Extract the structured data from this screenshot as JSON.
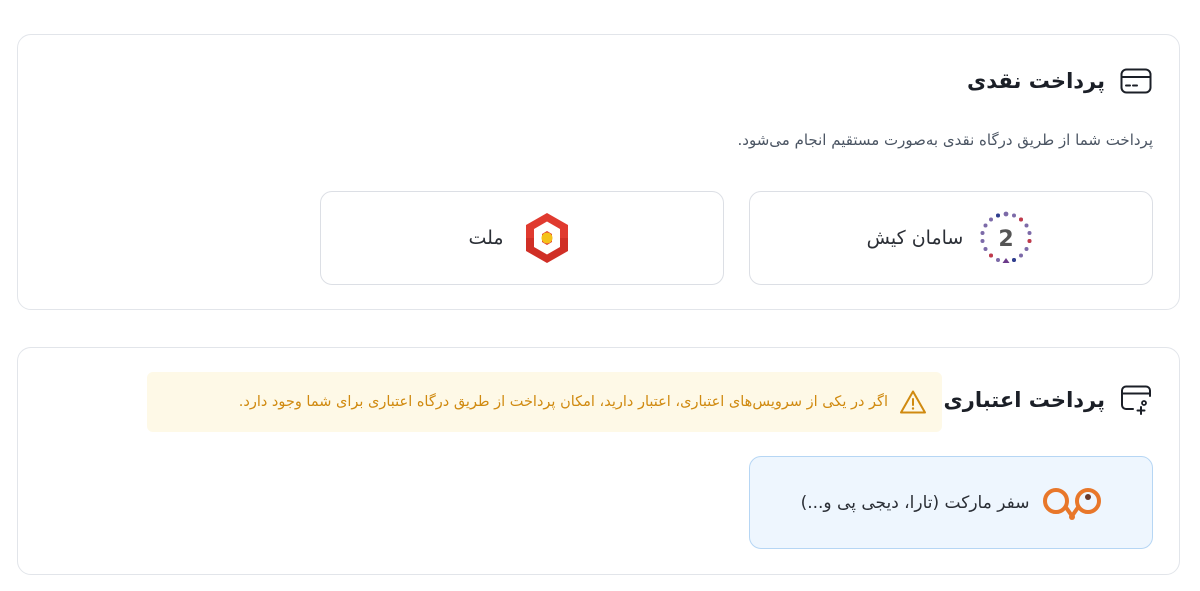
{
  "cash": {
    "title": "پرداخت نقدی",
    "description": "پرداخت شما از طریق درگاه نقدی به‌صورت مستقیم انجام می‌شود.",
    "icon": "card-icon",
    "gateways": [
      {
        "label": "سامان کیش",
        "icon": "saman-kish-logo"
      },
      {
        "label": "ملت",
        "icon": "mellat-logo"
      }
    ]
  },
  "credit": {
    "title": "پرداخت اعتباری",
    "icon": "card-add-icon",
    "notice": "اگر در یکی از سرویس‌های اعتباری، اعتبار دارید، امکان پرداخت از طریق درگاه اعتباری برای شما وجود دارد.",
    "notice_icon": "warning-icon",
    "notice_color": "#d08a10",
    "gateways": [
      {
        "label": "سفر مارکت (تارا، دیجی پی و...)",
        "icon": "safar-market-logo"
      }
    ]
  },
  "colors": {
    "mellat_red": "#e03a2f",
    "mellat_gold": "#f4c21b",
    "safar_orange": "#e8772a",
    "selected_bg": "#eef6fe",
    "selected_border": "#b6d6f4"
  }
}
